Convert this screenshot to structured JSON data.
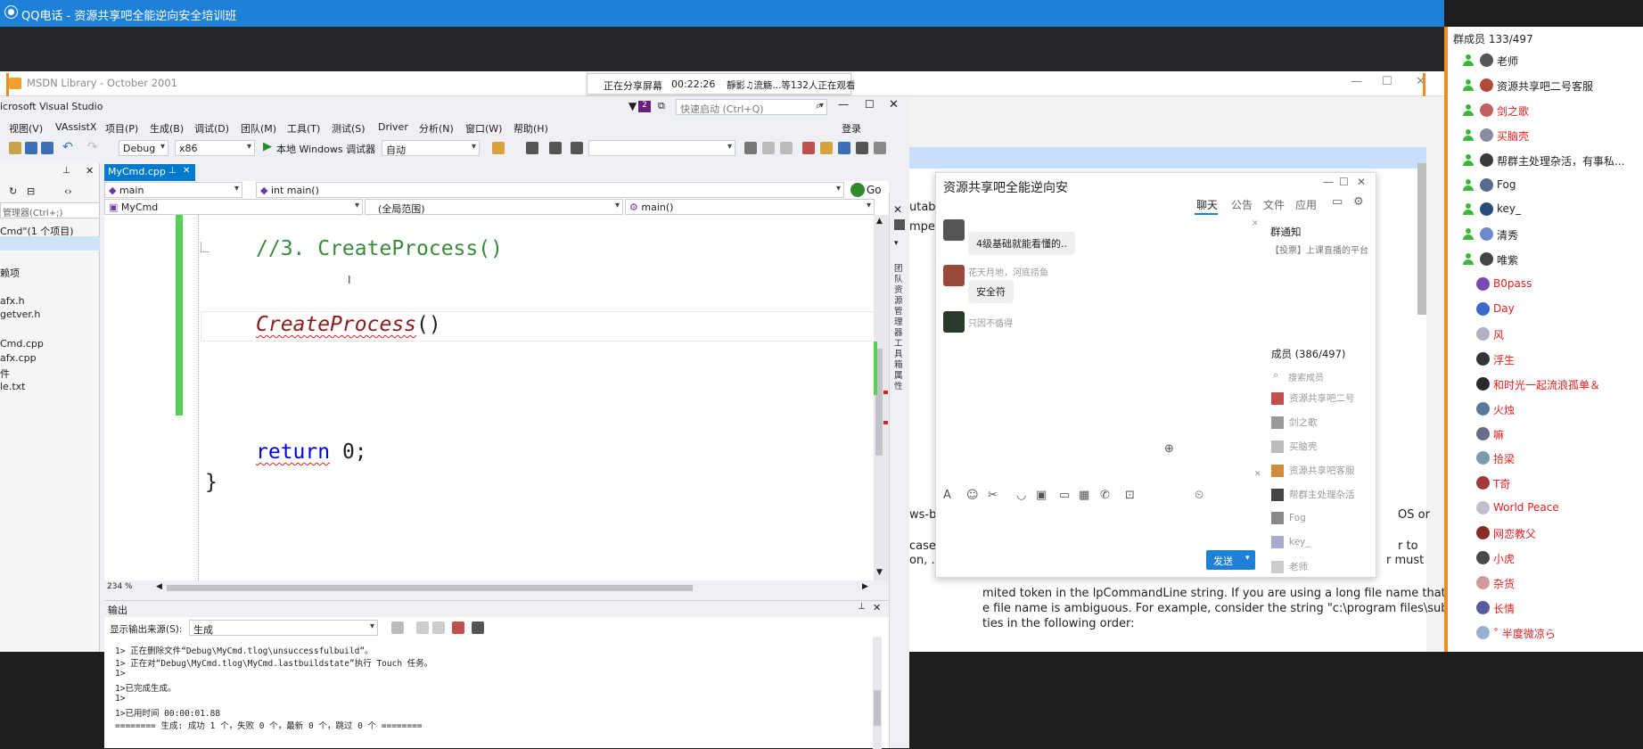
{
  "qq_window": {
    "title": "QQ电话 - 资源共享吧全能逆向安全培训班"
  },
  "msdn": {
    "title": "MSDN Library - October 2001"
  },
  "share_banner": {
    "status": "正在分享屏幕",
    "time": "00:22:26",
    "viewers": "靜影♫流觞...等132人正在观看"
  },
  "vs": {
    "title": "icrosoft Visual Studio",
    "quick_launch": "快速启动 (Ctrl+Q)",
    "notify_count": "2",
    "login": "登录",
    "menu": [
      "视图(V)",
      "VAssistX",
      "项目(P)",
      "生成(B)",
      "调试(D)",
      "团队(M)",
      "工具(T)",
      "测试(S)",
      "Driver",
      "分析(N)",
      "窗口(W)",
      "帮助(H)"
    ],
    "toolbar": {
      "config": "Debug",
      "platform": "x86",
      "debugger": "本地 Windows 调试器",
      "auto": "自动"
    },
    "solution_explorer": {
      "search": "管理器(Ctrl+;)",
      "items": [
        "Cmd\"(1 个项目)",
        "赖项",
        "afx.h",
        "getver.h",
        "Cmd.cpp",
        "afx.cpp",
        "件",
        "le.txt"
      ]
    },
    "tab": "MyCmd.cpp",
    "nav": {
      "scope": "main",
      "func": "int main()",
      "project": "MyCmd",
      "global": "(全局范围)",
      "member": "main()",
      "go": "Go"
    },
    "code": {
      "comment": "//3. CreateProcess()",
      "call_name": "CreateProcess",
      "call_parens": "()",
      "return_kw": "return",
      "return_val": " 0;",
      "close_brace": "}"
    },
    "zoom": "234 %",
    "right_strip": "团队资源管理器  工具箱  属性",
    "output": {
      "title": "输出",
      "source_label": "显示输出来源(S):",
      "source_value": "生成",
      "lines": [
        "1>        正在删除文件“Debug\\MyCmd.tlog\\unsuccessfulbuild”。",
        "1>        正在对“Debug\\MyCmd.tlog\\MyCmd.lastbuildstate”执行 Touch 任务。",
        "1>",
        "1>已完成生成。",
        "1>",
        "1>已用时间 00:00:01.88",
        "======== 生成: 成功 1 个，失败 0 个，最新 0 个，跳过 0 个 ========"
      ]
    }
  },
  "doc": {
    "partial": [
      "utab",
      "mper"
    ],
    "lines": [
      "ws-b",
      "OS or",
      "case",
      "r to",
      "on, .e",
      "r must",
      "mited token in the lpCommandLine string. If you are using a long file name that",
      "e file name is ambiguous. For example, consider the string \"c:\\program files\\sub",
      "ties in the following order:"
    ]
  },
  "qq_chat": {
    "title": "资源共享吧全能逆向安",
    "tabs": [
      "聊天",
      "公告",
      "文件",
      "应用"
    ],
    "messages": [
      {
        "sender": "",
        "text": "4级基础就能看懂的.."
      },
      {
        "sender": "花天月地，河底捞鱼",
        "text": "安全符"
      },
      {
        "sender": "只因不循得",
        "text": ""
      }
    ],
    "notice_title": "群通知",
    "notice_text": "【投票】上课直播的平台",
    "members_title": "成员 (386/497)",
    "search_placeholder": "搜索成员",
    "members": [
      "资源共享吧二号",
      "剑之歌",
      "买脑壳",
      "资源共享吧客服",
      "帮群主处理杂活",
      "Fog",
      "key_",
      "老师"
    ],
    "send": "发送"
  },
  "sidebar": {
    "header": "群成员 133/497",
    "members": [
      {
        "name": "老师",
        "color": "#222222",
        "icon": "green"
      },
      {
        "name": "资源共享吧二号客服",
        "color": "#222222",
        "icon": "green"
      },
      {
        "name": "剑之歌",
        "color": "#e02020",
        "icon": "green"
      },
      {
        "name": "买脑壳",
        "color": "#e02020",
        "icon": "green"
      },
      {
        "name": "帮群主处理杂活，有事私...",
        "color": "#222222",
        "icon": "green"
      },
      {
        "name": "Fog",
        "color": "#222222",
        "icon": "green"
      },
      {
        "name": "key_",
        "color": "#222222",
        "icon": "green"
      },
      {
        "name": "清秀",
        "color": "#222222",
        "icon": "green"
      },
      {
        "name": "唯紫",
        "color": "#222222",
        "icon": "green"
      },
      {
        "name": "B0pass",
        "color": "#e02020",
        "icon": "none"
      },
      {
        "name": "Day",
        "color": "#e02020",
        "icon": "none"
      },
      {
        "name": "风",
        "color": "#e02020",
        "icon": "none"
      },
      {
        "name": "浮生",
        "color": "#e02020",
        "icon": "none"
      },
      {
        "name": "和时光一起流浪孤单＆",
        "color": "#e02020",
        "icon": "none"
      },
      {
        "name": "火烛",
        "color": "#e02020",
        "icon": "none"
      },
      {
        "name": "嘛",
        "color": "#e02020",
        "icon": "none"
      },
      {
        "name": "拾梁",
        "color": "#e02020",
        "icon": "none"
      },
      {
        "name": "T奇",
        "color": "#e02020",
        "icon": "none"
      },
      {
        "name": "World Peace",
        "color": "#e02020",
        "icon": "none"
      },
      {
        "name": "网恋教父",
        "color": "#e02020",
        "icon": "none"
      },
      {
        "name": "小虎",
        "color": "#e02020",
        "icon": "none"
      },
      {
        "name": "杂货",
        "color": "#e02020",
        "icon": "none"
      },
      {
        "name": "长情",
        "color": "#e02020",
        "icon": "none"
      },
      {
        "name": "˚ 半度微凉ら",
        "color": "#e02020",
        "icon": "none"
      }
    ]
  },
  "colors": {
    "accent": "#1f80d8",
    "vs_tab": "#007acc",
    "error": "#e02020",
    "added_line": "#55d055"
  }
}
